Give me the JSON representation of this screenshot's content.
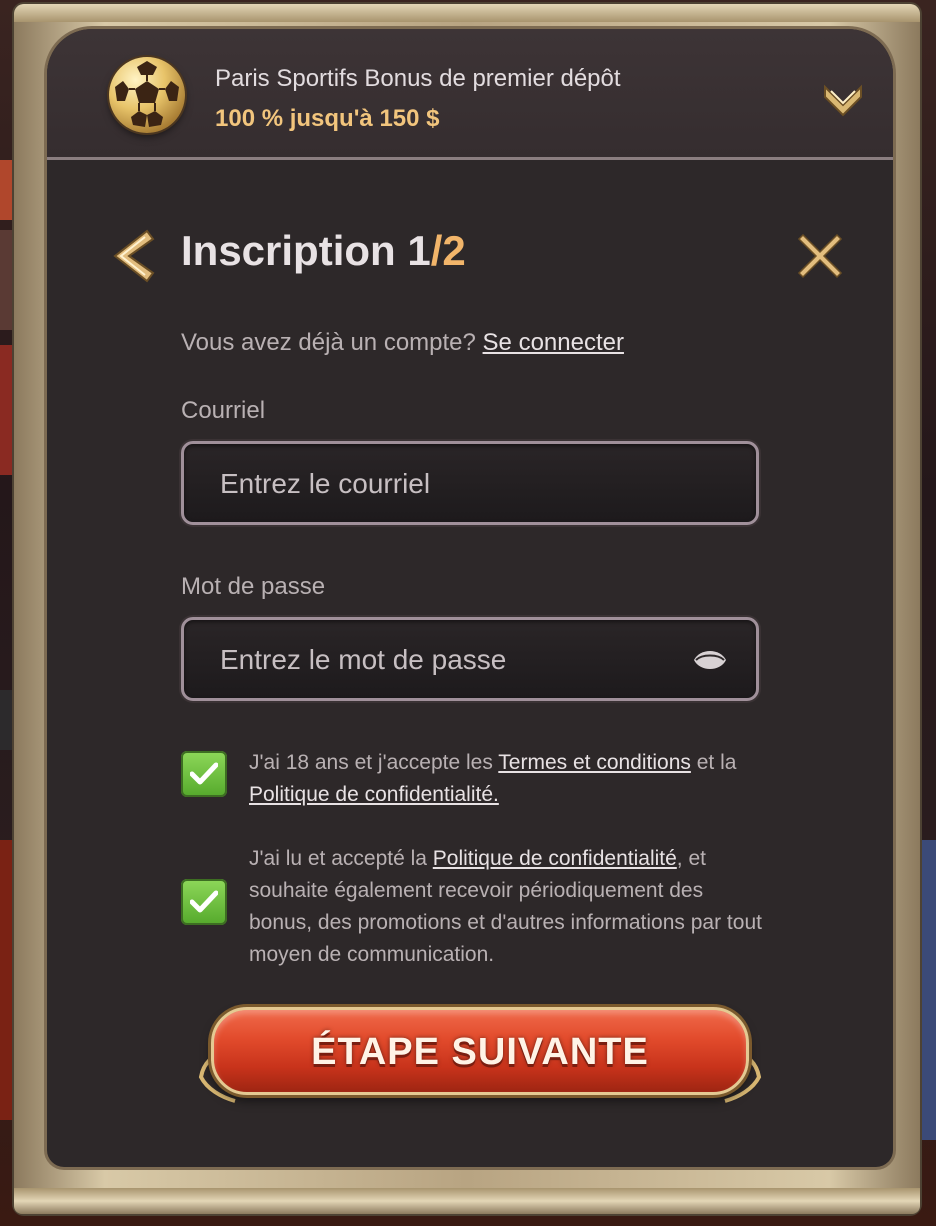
{
  "bonus": {
    "title": "Paris Sportifs Bonus de premier dépôt",
    "amount": "100 % jusqu'à 150 $",
    "icon": "soccer-ball-icon",
    "toggle_icon": "chevron-down-icon"
  },
  "header": {
    "title": "Inscription 1",
    "step_suffix": "/2",
    "back_icon": "chevron-left-icon",
    "close_icon": "close-icon"
  },
  "login": {
    "prompt": "Vous avez déjà un compte?",
    "link": "Se connecter"
  },
  "form": {
    "email": {
      "label": "Courriel",
      "value": "",
      "placeholder": "Entrez le courriel"
    },
    "password": {
      "label": "Mot de passe",
      "value": "",
      "placeholder": "Entrez le mot de passe",
      "toggle_icon": "eye-icon"
    }
  },
  "consents": [
    {
      "checked": true,
      "text_before": "J'ai 18 ans et j'accepte les ",
      "link1": "Termes et conditions",
      "text_middle": " et la ",
      "link2": "Politique de confidentialité."
    },
    {
      "checked": true,
      "text_before": "J'ai lu et accepté la ",
      "link1": "Politique de confidentialité",
      "text_after": ", et souhaite également recevoir périodiquement des bonus, des promotions et d'autres informations par tout moyen de communication."
    }
  ],
  "cta": {
    "label": "ÉTAPE SUIVANTE"
  },
  "colors": {
    "accent": "#f2b56a",
    "panel": "#2d2829",
    "checkbox": "#6cc13c",
    "cta": "#e24b2c",
    "frame": "#c9b793"
  }
}
